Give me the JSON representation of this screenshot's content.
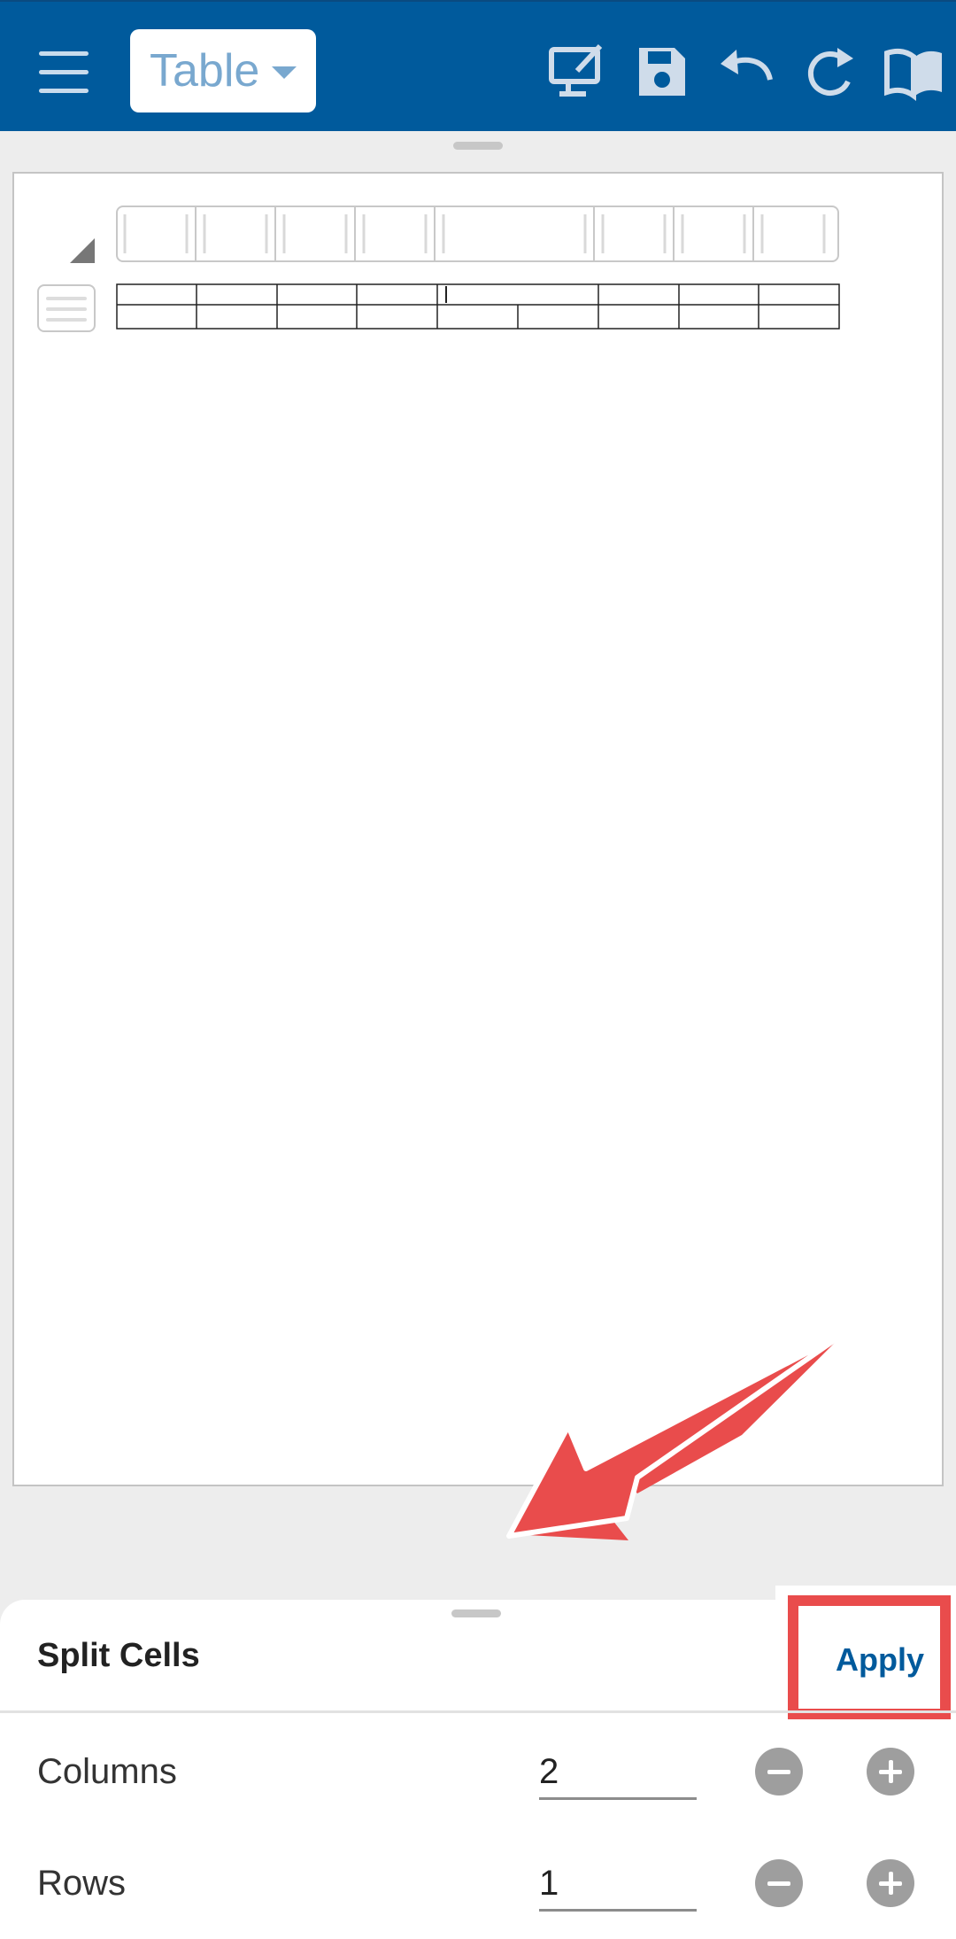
{
  "toolbar": {
    "mode_label": "Table",
    "icons": [
      "hamburger-menu-icon",
      "monitor-edit-icon",
      "save-icon",
      "undo-icon",
      "redo-icon",
      "book-icon"
    ]
  },
  "split_cells": {
    "title": "Split Cells",
    "apply_label": "Apply",
    "columns_label": "Columns",
    "columns_value": "2",
    "rows_label": "Rows",
    "rows_value": "1"
  },
  "colors": {
    "toolbar": "#005a9c",
    "highlight": "#e94c4c",
    "accent_text": "#005a9c"
  }
}
